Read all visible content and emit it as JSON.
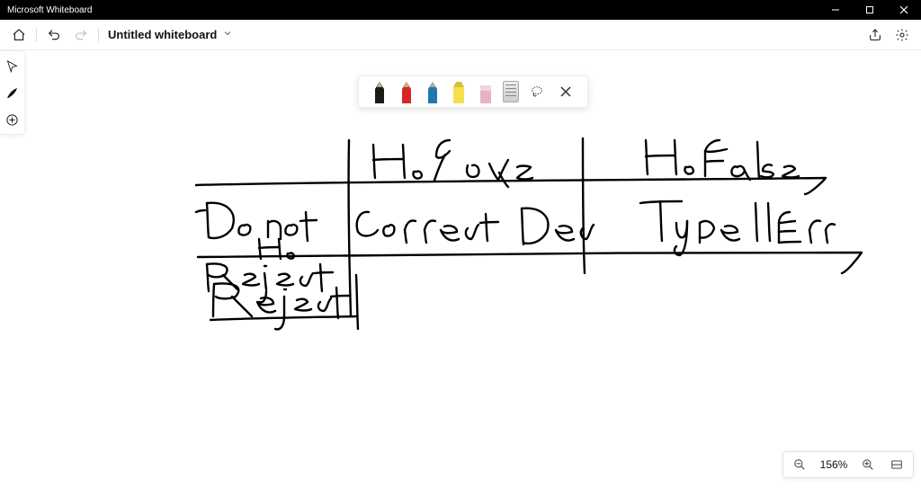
{
  "window": {
    "title": "Microsoft Whiteboard"
  },
  "header": {
    "board_title": "Untitled whiteboard"
  },
  "left_tools": {
    "select": "select-tool",
    "ink": "ink-tool",
    "add": "add-tool"
  },
  "pen_toolbar": {
    "pens": [
      {
        "name": "pen-black",
        "color": "#1a1a1a"
      },
      {
        "name": "pen-red",
        "color": "#d62728"
      },
      {
        "name": "pen-blue",
        "color": "#1f77b4"
      },
      {
        "name": "highlighter-yellow",
        "color": "#f4e04d"
      },
      {
        "name": "eraser",
        "color": "#e6b3c3"
      },
      {
        "name": "ruler",
        "color": "#cccccc"
      }
    ],
    "lasso": "lasso-select",
    "close": "close"
  },
  "zoom": {
    "label": "156%"
  },
  "handwriting": {
    "col_headers": [
      "H₀ True",
      "H₀ False"
    ],
    "row_headers": [
      "Do not Reject H₀",
      "Reject H₀"
    ],
    "cells": {
      "r0c0": "Correct Decision",
      "r0c1": "Type II Error",
      "r1c0": "",
      "r1c1": ""
    }
  }
}
